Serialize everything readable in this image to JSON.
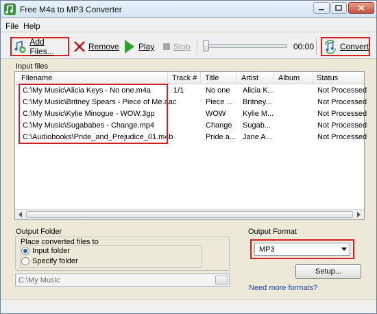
{
  "window": {
    "title": "Free M4a to MP3 Converter"
  },
  "menu": [
    {
      "label": "File"
    },
    {
      "label": "Help"
    }
  ],
  "toolbar": {
    "add_files": "Add Files...",
    "remove": "Remove",
    "play": "Play",
    "stop": "Stop",
    "time": "00:00",
    "convert": "Convert",
    "seek_progress": 0
  },
  "input_files": {
    "label": "Input files",
    "columns": [
      "Filename",
      "Track #",
      "Title",
      "Artist",
      "Album",
      "Status"
    ],
    "rows": [
      {
        "filename": "C:\\My Music\\Alicia Keys - No one.m4a",
        "track": "1/1",
        "title": "No one",
        "artist": "Alicia K...",
        "album": "",
        "status": "Not Processed"
      },
      {
        "filename": "C:\\My Music\\Britney Spears - Piece of Me.aac",
        "track": "",
        "title": "Piece ...",
        "artist": "Britney...",
        "album": "",
        "status": "Not Processed"
      },
      {
        "filename": "C:\\My Music\\Kylie Minogue - WOW.3gp",
        "track": "",
        "title": "WOW",
        "artist": "Kylie M...",
        "album": "",
        "status": "Not Processed"
      },
      {
        "filename": "C:\\My Music\\Sugababes - Change.mp4",
        "track": "",
        "title": "Change",
        "artist": "Sugab...",
        "album": "",
        "status": "Not Processed"
      },
      {
        "filename": "C:\\Audiobooks\\Pride_and_Prejudice_01.m4b",
        "track": "",
        "title": "Pride a...",
        "artist": "Jane A...",
        "album": "",
        "status": "Not Processed"
      }
    ]
  },
  "output_folder": {
    "label": "Output Folder",
    "group_label": "Place converted files to",
    "option_input": "Input folder",
    "option_specify": "Specify folder",
    "selected": "input",
    "path": "C:\\My Music"
  },
  "output_format": {
    "label": "Output Format",
    "selected": "MP3",
    "setup_button": "Setup...",
    "more_link": "Need more formats?"
  },
  "colors": {
    "highlight": "#d42020",
    "link": "#1c43a8",
    "play_green": "#2e9e2e",
    "remove_red": "#b01818"
  }
}
